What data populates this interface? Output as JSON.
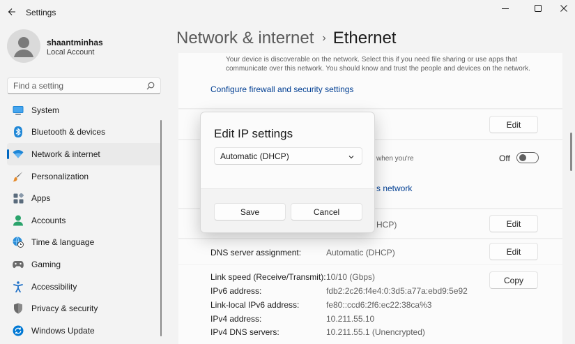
{
  "app": {
    "title": "Settings"
  },
  "window": {
    "minimize_icon": "minimize-icon",
    "maximize_icon": "maximize-icon",
    "close_icon": "close-icon"
  },
  "account": {
    "name": "shaantminhas",
    "type": "Local Account"
  },
  "search": {
    "placeholder": "Find a setting",
    "icon": "search-icon"
  },
  "sidebar": {
    "items": [
      {
        "label": "System",
        "icon": "system-icon",
        "color": "#0078d4"
      },
      {
        "label": "Bluetooth & devices",
        "icon": "bluetooth-icon",
        "color": "#0078d4"
      },
      {
        "label": "Network & internet",
        "icon": "wifi-icon",
        "color": "#0078d4",
        "active": true
      },
      {
        "label": "Personalization",
        "icon": "brush-icon",
        "color": "#e58a2a"
      },
      {
        "label": "Apps",
        "icon": "apps-icon",
        "color": "#5a6b7c"
      },
      {
        "label": "Accounts",
        "icon": "person-icon",
        "color": "#2aa36b"
      },
      {
        "label": "Time & language",
        "icon": "globe-clock-icon",
        "color": "#2b8fd9"
      },
      {
        "label": "Gaming",
        "icon": "gamepad-icon",
        "color": "#6b6b6b"
      },
      {
        "label": "Accessibility",
        "icon": "accessibility-icon",
        "color": "#1c6fc7"
      },
      {
        "label": "Privacy & security",
        "icon": "shield-icon",
        "color": "#6b6b6b"
      },
      {
        "label": "Windows Update",
        "icon": "update-icon",
        "color": "#0078d4"
      }
    ]
  },
  "breadcrumb": {
    "parent": "Network & internet",
    "separator": "›",
    "current": "Ethernet"
  },
  "main": {
    "description": "Your device is discoverable on the network. Select this if you need file sharing or use apps that communicate over this network. You should know and trust the people and devices on the network.",
    "firewall_link": "Configure firewall and security settings",
    "edit_label": "Edit",
    "partial_metered": "when you're",
    "toggle_state": "Off",
    "partial_network_link": "s network",
    "partial_dhcp": "HCP)",
    "dns_label": "DNS server assignment:",
    "dns_value": "Automatic (DHCP)",
    "copy_label": "Copy",
    "properties": [
      {
        "label": "Link speed (Receive/Transmit):",
        "value": "10/10 (Gbps)"
      },
      {
        "label": "IPv6 address:",
        "value": "fdb2:2c26:f4e4:0:3d5:a77a:ebd9:5e92"
      },
      {
        "label": "Link-local IPv6 address:",
        "value": "fe80::ccd6:2f6:ec22:38ca%3"
      },
      {
        "label": "IPv4 address:",
        "value": "10.211.55.10"
      },
      {
        "label": "IPv4 DNS servers:",
        "value": "10.211.55.1 (Unencrypted)"
      }
    ]
  },
  "dialog": {
    "title": "Edit IP settings",
    "selected_option": "Automatic (DHCP)",
    "save_label": "Save",
    "cancel_label": "Cancel"
  },
  "colors": {
    "accent": "#0067c0",
    "link": "#003e92"
  }
}
